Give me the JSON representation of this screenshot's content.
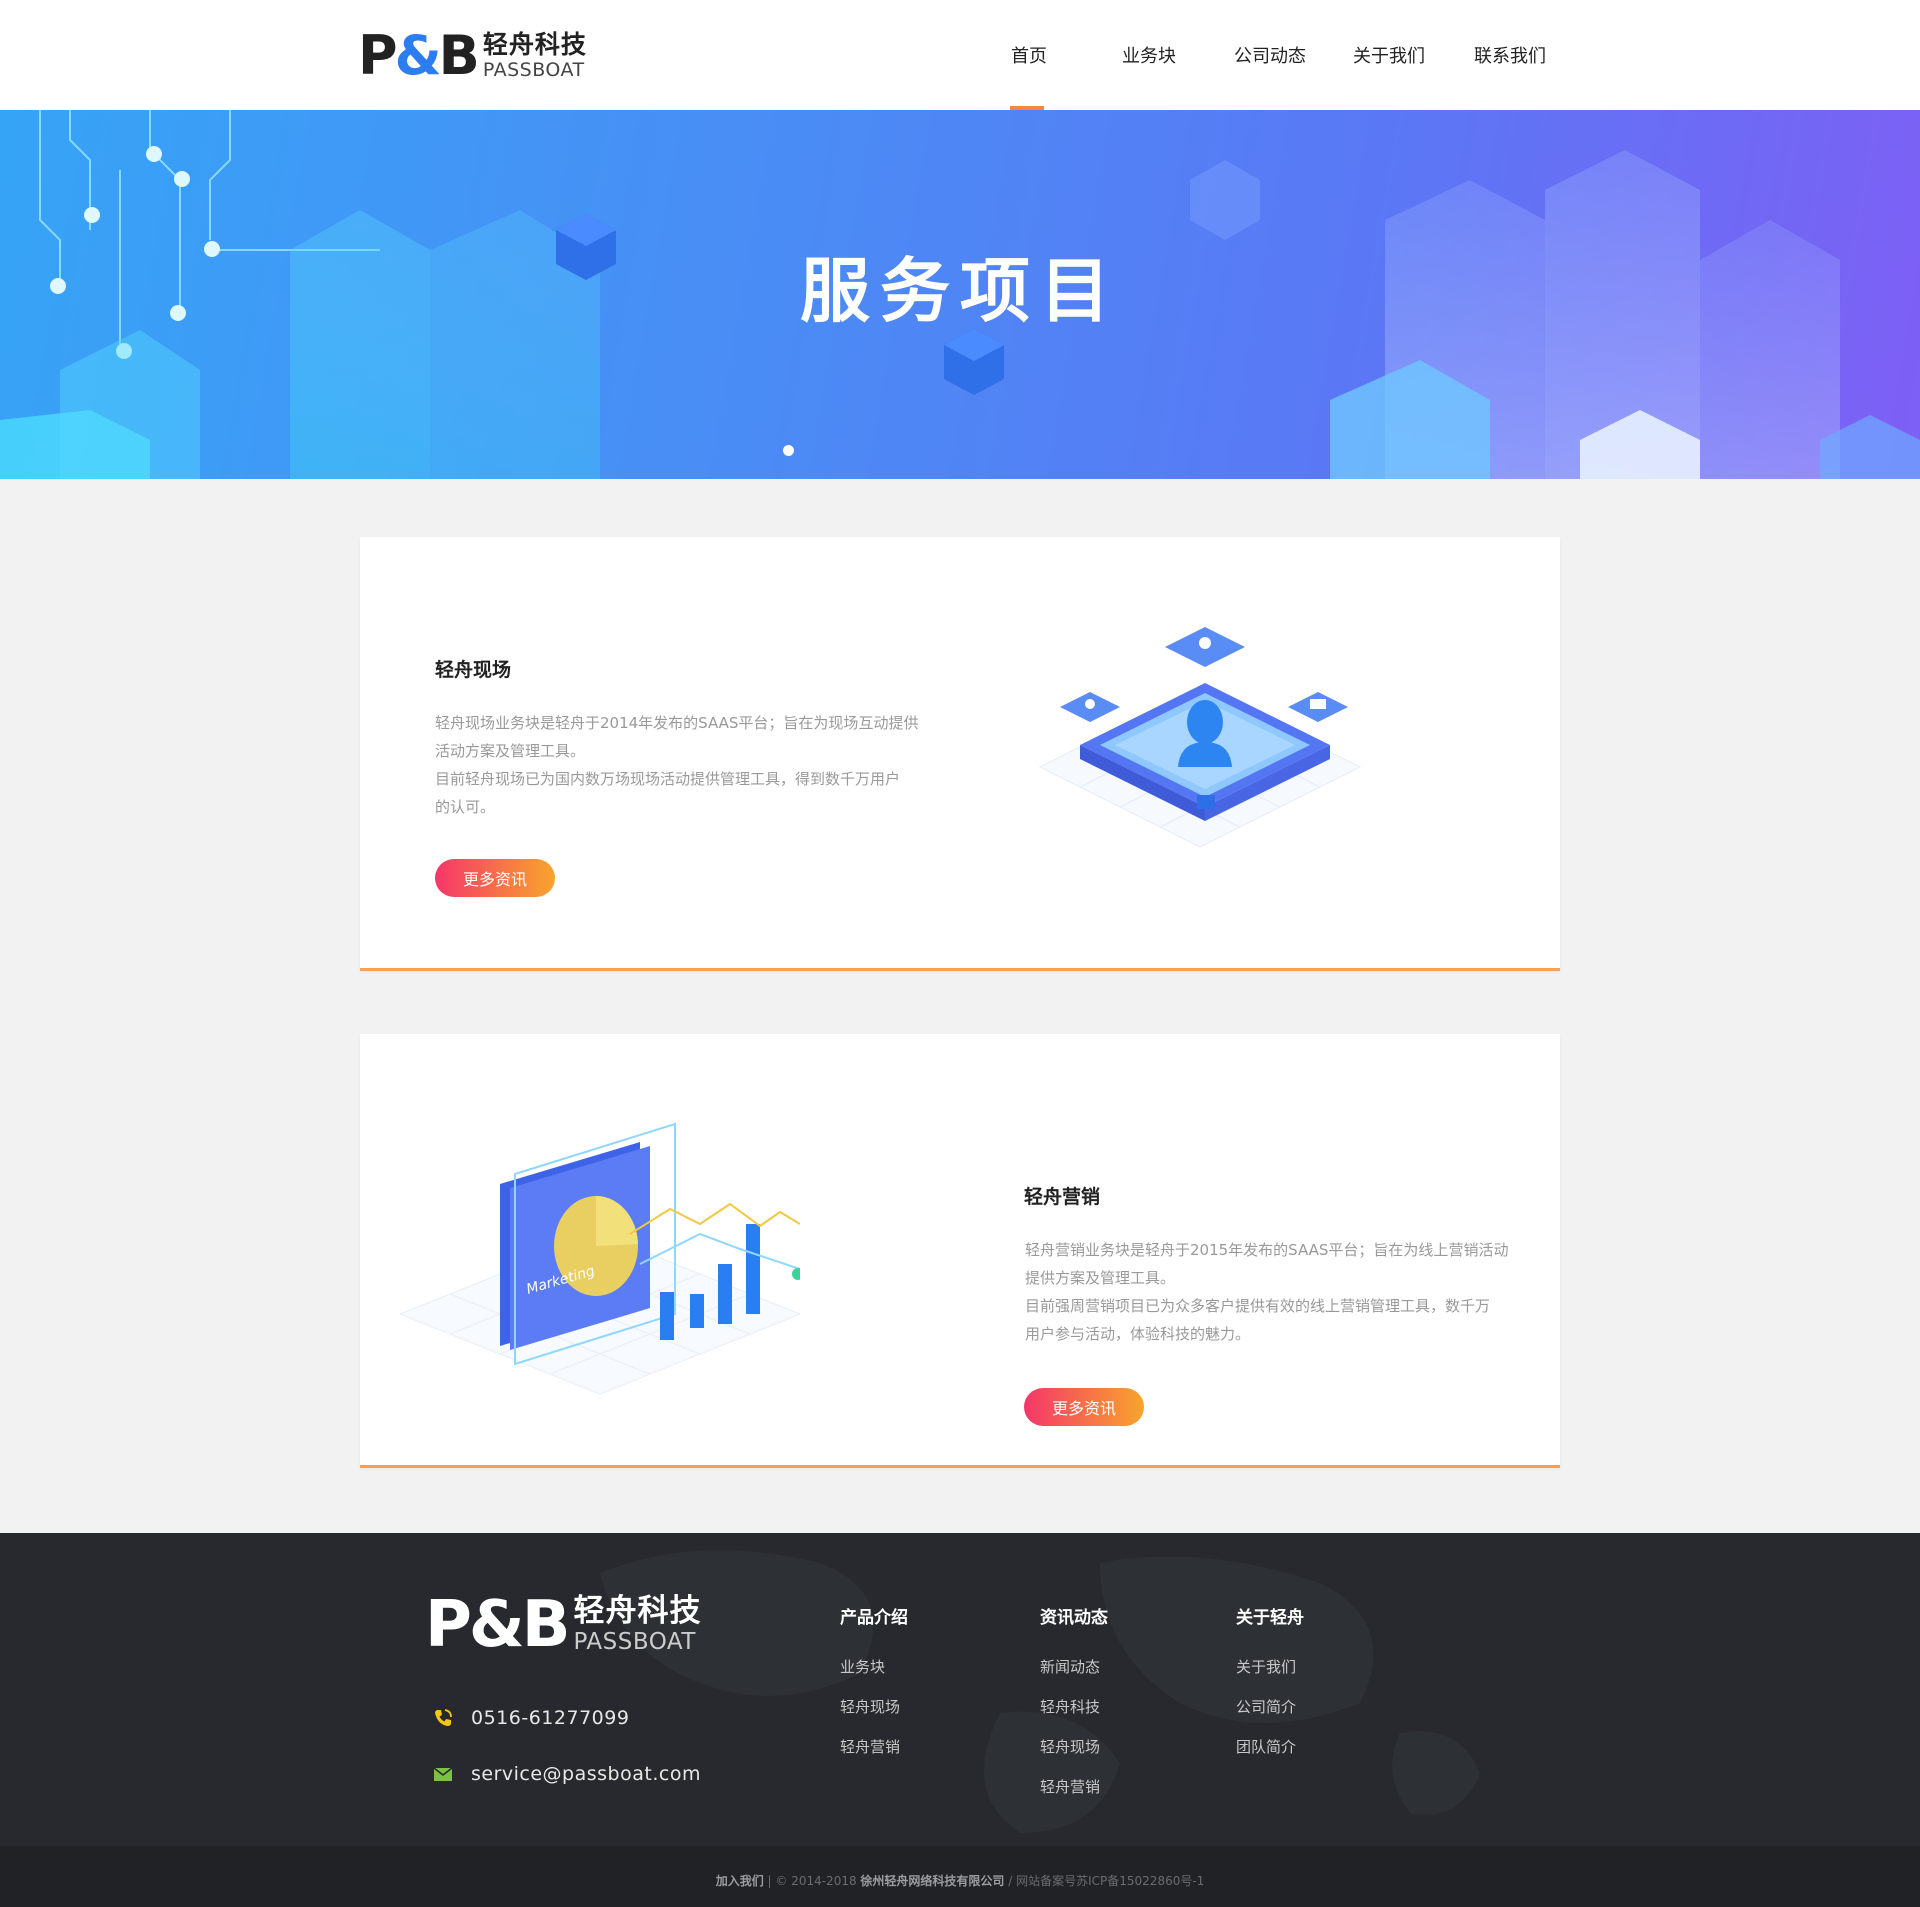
{
  "brand": {
    "mark_p": "P",
    "mark_amp": "&",
    "mark_b": "B",
    "name_cn": "轻舟科技",
    "name_en": "PASSBOAT"
  },
  "nav": {
    "items": [
      {
        "label": "首页",
        "active": true
      },
      {
        "label": "业务块"
      },
      {
        "label": "公司动态"
      },
      {
        "label": "关于我们"
      },
      {
        "label": "联系我们"
      }
    ],
    "active_color": "#f5893a"
  },
  "banner": {
    "title": "服务项目"
  },
  "services": [
    {
      "title": "轻舟现场",
      "desc": [
        "轻舟现场业务块是轻舟于2014年发布的SAAS平台；旨在为现场互动提供",
        "活动方案及管理工具。",
        "目前轻舟现场已为国内数万场现场活动提供管理工具，得到数千万用户",
        "的认可。"
      ],
      "button": "更多资讯"
    },
    {
      "title": "轻舟营销",
      "desc": [
        "轻舟营销业务块是轻舟于2015年发布的SAAS平台；旨在为线上营销活动",
        "提供方案及管理工具。",
        "目前强周营销项目已为众多客户提供有效的线上营销管理工具，数千万",
        "用户参与活动，体验科技的魅力。"
      ],
      "button": "更多资讯",
      "illustration_label": "Marketing"
    }
  ],
  "footer": {
    "phone": "0516-61277099",
    "email": "service@passboat.com",
    "columns": [
      {
        "title": "产品介绍",
        "links": [
          "业务块",
          "轻舟现场",
          "轻舟营销"
        ]
      },
      {
        "title": "资讯动态",
        "links": [
          "新闻动态",
          "轻舟科技",
          "轻舟现场",
          "轻舟营销"
        ]
      },
      {
        "title": "关于轻舟",
        "links": [
          "关于我们",
          "公司简介",
          "团队简介"
        ]
      }
    ]
  },
  "copyright": {
    "join": "加入我们",
    "sep1": " | © 2014-2018 ",
    "company": "徐州轻舟网络科技有限公司",
    "sep2": " / ",
    "icp": "网站备案号苏ICP备15022860号-1"
  },
  "colors": {
    "accent_orange": "#f5a052",
    "button_start": "#f5366a",
    "button_end": "#f8a52c",
    "banner_start": "#36a4f6",
    "banner_end": "#7e5ff5",
    "footer_bg": "#27292e"
  }
}
